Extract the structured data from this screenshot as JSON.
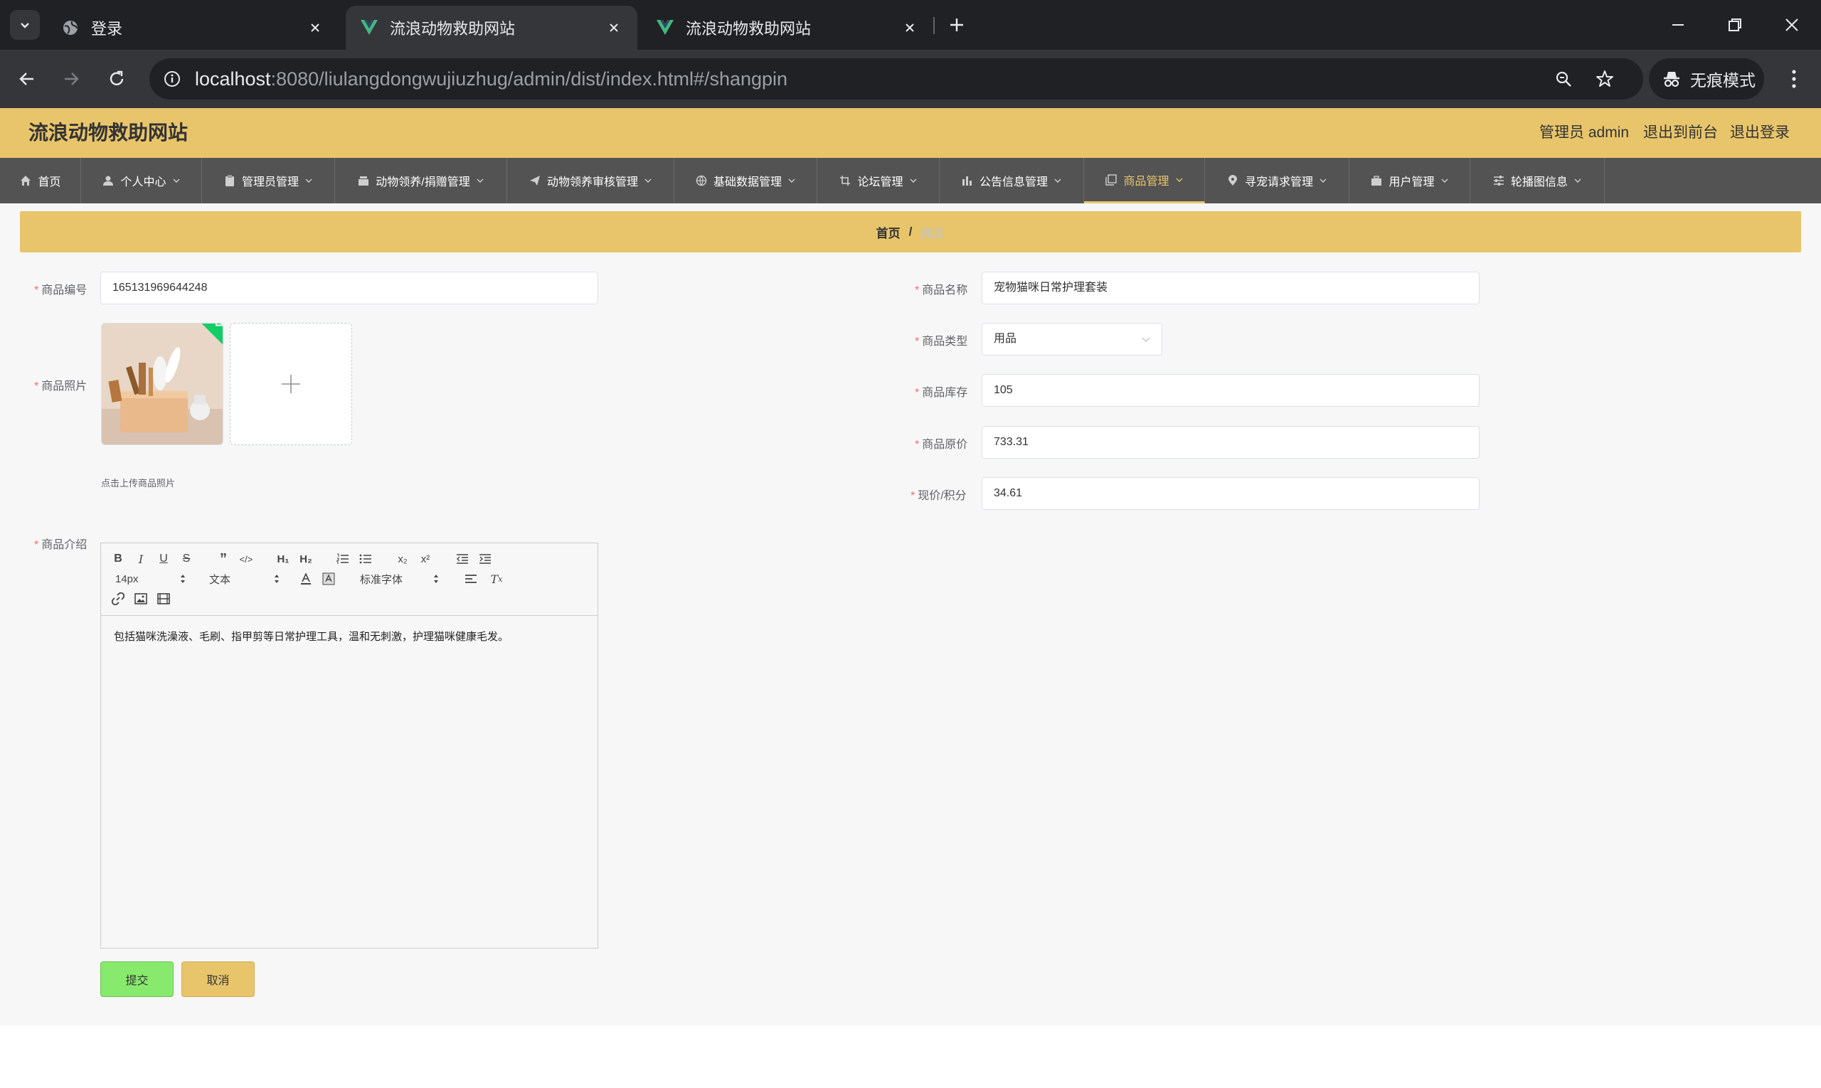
{
  "browser": {
    "tabs": [
      {
        "title": "登录",
        "favicon": "globe-icon"
      },
      {
        "title": "流浪动物救助网站",
        "favicon": "vue-logo-icon"
      },
      {
        "title": "流浪动物救助网站",
        "favicon": "vue-logo-icon"
      }
    ],
    "url_host": "localhost",
    "url_rest": ":8080/liulangdongwujiuzhug/admin/dist/index.html#/shangpin",
    "incognito_label": "无痕模式"
  },
  "header": {
    "site_title": "流浪动物救助网站",
    "user_label": "管理员 admin",
    "to_front_label": "退出到前台",
    "logout_label": "退出登录",
    "accent_color": "#e8c56b"
  },
  "nav": {
    "items": [
      {
        "label": "首页",
        "icon": "home-icon"
      },
      {
        "label": "个人中心",
        "icon": "user-icon"
      },
      {
        "label": "管理员管理",
        "icon": "clipboard-icon"
      },
      {
        "label": "动物领养/捐赠管理",
        "icon": "box-icon"
      },
      {
        "label": "动物领养审核管理",
        "icon": "send-icon"
      },
      {
        "label": "基础数据管理",
        "icon": "globe-icon"
      },
      {
        "label": "论坛管理",
        "icon": "crop-icon"
      },
      {
        "label": "公告信息管理",
        "icon": "chart-icon"
      },
      {
        "label": "商品管理",
        "icon": "copy-icon"
      },
      {
        "label": "寻宠请求管理",
        "icon": "location-icon"
      },
      {
        "label": "用户管理",
        "icon": "briefcase-icon"
      },
      {
        "label": "轮播图信息",
        "icon": "sliders-icon"
      }
    ],
    "active_index": 8
  },
  "breadcrumb": {
    "home": "首页",
    "separator": "/",
    "current": "商品"
  },
  "form": {
    "code_label": "商品编号",
    "code_value": "165131969644248",
    "photo_label": "商品照片",
    "upload_tip": "点击上传商品照片",
    "intro_label": "商品介绍",
    "name_label": "商品名称",
    "name_value": "宠物猫咪日常护理套装",
    "type_label": "商品类型",
    "type_value": "用品",
    "stock_label": "商品库存",
    "stock_value": "105",
    "orig_price_label": "商品原价",
    "orig_price_value": "733.31",
    "now_price_label": "现价/积分",
    "now_price_value": "34.61",
    "required_mark": "*"
  },
  "editor": {
    "size_value": "14px",
    "header_value": "文本",
    "font_value": "标准字体",
    "content": "包括猫咪洗澡液、毛刷、指甲剪等日常护理工具，温和无刺激，护理猫咪健康毛发。"
  },
  "buttons": {
    "submit": "提交",
    "cancel": "取消"
  }
}
